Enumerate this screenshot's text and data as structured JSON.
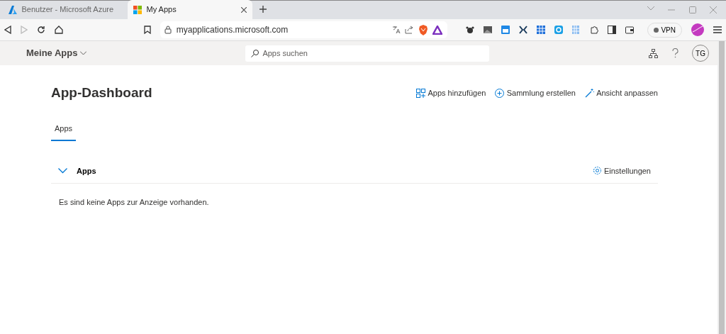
{
  "browser": {
    "tabs": [
      {
        "title": "Benutzer - Microsoft Azure",
        "selected": false,
        "kind": "azure"
      },
      {
        "title": "My Apps",
        "selected": true,
        "kind": "microsoft"
      }
    ],
    "address": "myapplications.microsoft.com",
    "vpn": "VPN"
  },
  "app_header": {
    "title": "Meine Apps",
    "search": {
      "placeholder": "Apps suchen"
    },
    "avatar": "TG"
  },
  "dashboard": {
    "title": "App-Dashboard",
    "actions": [
      {
        "label": "Apps hinzufügen",
        "kind": "add"
      },
      {
        "label": "Sammlung erstellen",
        "kind": "collection"
      },
      {
        "label": "Ansicht anpassen",
        "kind": "customize"
      }
    ],
    "tabs": [
      {
        "label": "Apps",
        "selected": true
      }
    ],
    "section": {
      "title": "Apps",
      "expanded": true,
      "settings": "Einstellungen",
      "empty_message": "Es sind keine Apps zur Anzeige vorhanden."
    }
  }
}
